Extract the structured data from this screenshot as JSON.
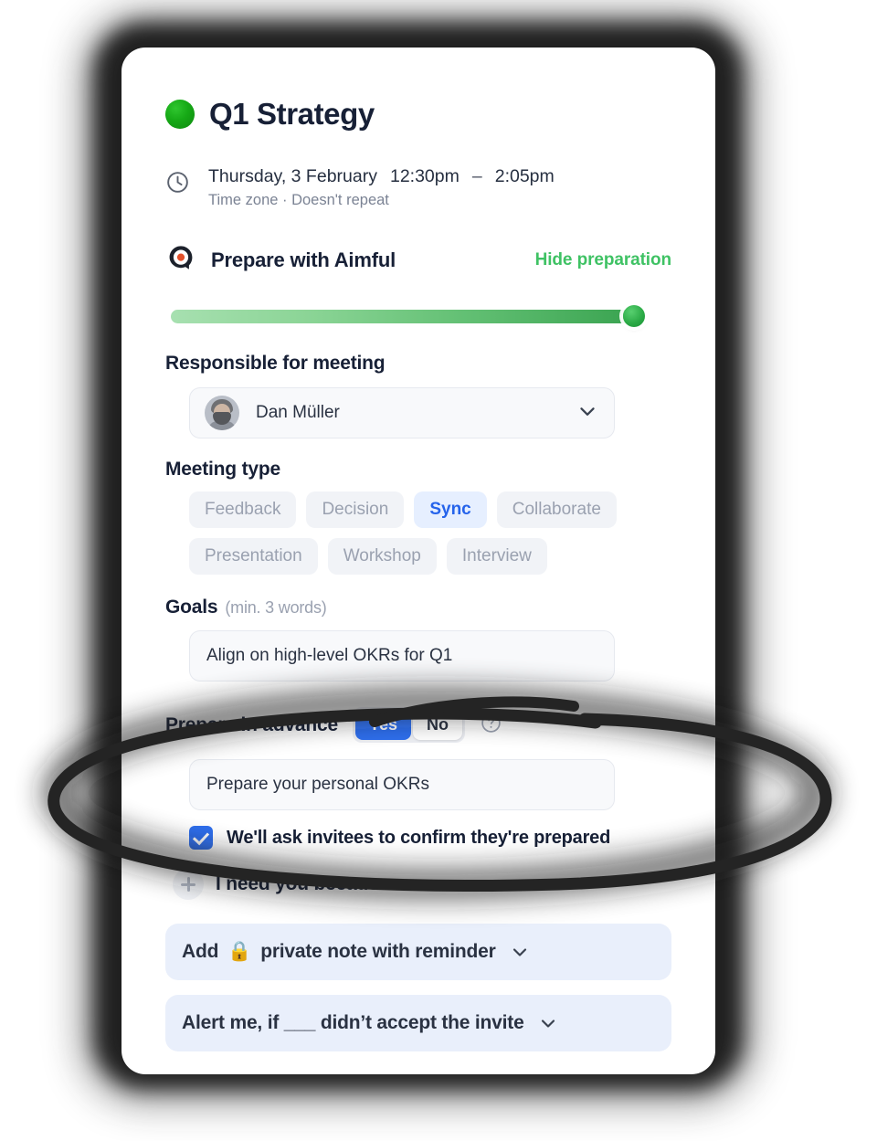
{
  "meeting": {
    "status_color": "#16a916",
    "title": "Q1 Strategy",
    "date": "Thursday, 3 February",
    "time_start": "12:30pm",
    "time_separator": "–",
    "time_end": "2:05pm",
    "meta": "Time zone · Doesn't repeat",
    "clock_icon": "clock-icon"
  },
  "preparation": {
    "brand_icon": "aimful-logo-icon",
    "heading": "Prepare with Aimful",
    "toggle_link": "Hide preparation",
    "toggle_link_color": "#3fc264",
    "progress": {
      "percent": 100,
      "gradient_from": "#a7e0b0",
      "gradient_to": "#37a14e"
    },
    "responsible": {
      "label": "Responsible for meeting",
      "value": "Dan Müller",
      "chevron_icon": "chevron-down-icon"
    },
    "meeting_type": {
      "label": "Meeting type",
      "selected": "Sync",
      "selected_bg": "#e6efff",
      "selected_fg": "#2563eb",
      "options": [
        "Feedback",
        "Decision",
        "Sync",
        "Collaborate",
        "Presentation",
        "Workshop",
        "Interview"
      ]
    },
    "goals": {
      "label": "Goals",
      "hint": "(min. 3 words)",
      "value": "Align on high-level OKRs for Q1"
    },
    "prepare_in_advance": {
      "label": "Prepare in advance",
      "yes_label": "Yes",
      "no_label": "No",
      "selected": "Yes",
      "selected_bg": "#2f6fed",
      "help_icon": "help-circle-icon",
      "task_value": "Prepare your personal OKRs",
      "confirm_label": "We'll ask invitees to confirm they're prepared",
      "confirm_checked": true
    },
    "add_reason": {
      "plus_icon": "plus-icon",
      "label": "I need you because..."
    }
  },
  "actions": [
    {
      "prefix": "Add",
      "emoji": "🔒",
      "text": "private note with reminder",
      "chevron_icon": "chevron-down-icon"
    },
    {
      "prefix": "",
      "emoji": "",
      "text": "Alert me, if ___ didn’t accept the invite",
      "chevron_icon": "chevron-down-icon"
    }
  ],
  "annotation": {
    "shape": "hand-drawn-ellipse",
    "color": "#242424"
  }
}
